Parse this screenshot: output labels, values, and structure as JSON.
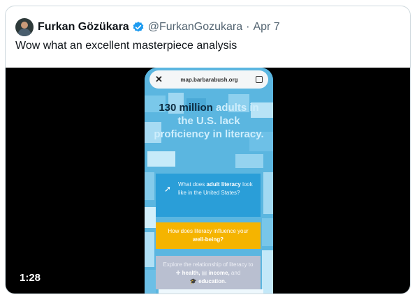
{
  "tweet": {
    "author_name": "Furkan Gözükara",
    "handle": "@FurkanGozukara",
    "separator": "·",
    "date": "Apr 7",
    "text": "Wow what an excellent masterpiece analysis",
    "verified_color": "#1d9bf0"
  },
  "video": {
    "duration": "1:28",
    "phone_screen": {
      "url": "map.barbarabush.org",
      "close_glyph": "✕",
      "headline_dark_1": "130 million",
      "headline_light_1": "adults in the U.S. lack proficiency in literacy.",
      "card1_prefix": "What does",
      "card1_bold": "adult literacy",
      "card1_suffix": "look like in the United States?",
      "card2_prefix": "How does literacy influence your",
      "card2_bold": "well-being?",
      "card3_prefix": "Explore the relationship of literacy to",
      "card3_health": "health,",
      "card3_income": "income,",
      "card3_and": "and",
      "card3_education": "education."
    }
  }
}
